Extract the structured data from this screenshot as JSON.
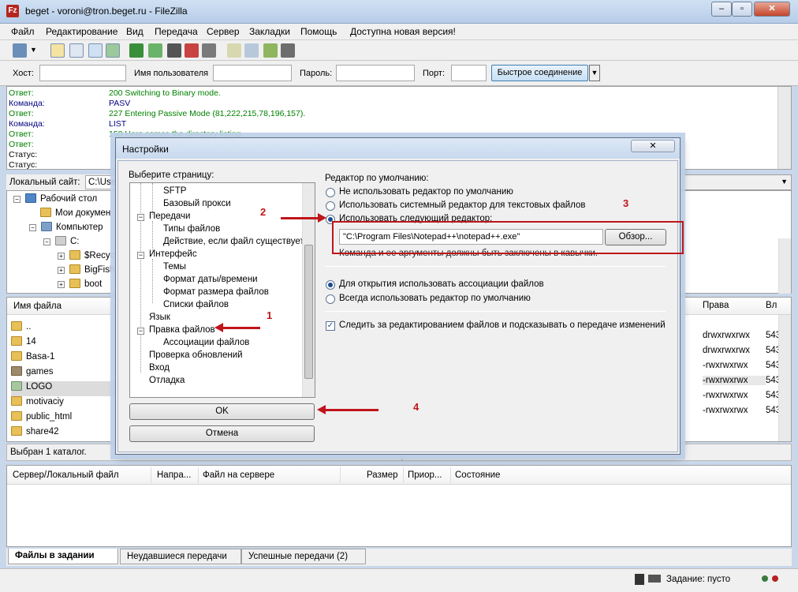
{
  "window": {
    "title": "beget - voroni@tron.beget.ru - FileZilla",
    "icon_label": "Fz",
    "minimize": "‒",
    "maximize": "▫",
    "close": "✕"
  },
  "menu": [
    "Файл",
    "Редактирование",
    "Вид",
    "Передача",
    "Сервер",
    "Закладки",
    "Помощь",
    "Доступна новая версия!"
  ],
  "quickconnect": {
    "host_label": "Хост:",
    "user_label": "Имя пользователя",
    "pass_label": "Пароль:",
    "port_label": "Порт:",
    "button": "Быстрое соединение",
    "dropdown": "▼"
  },
  "log": [
    {
      "k": "Ответ:",
      "v": "200 Switching to Binary mode.",
      "t": "resp"
    },
    {
      "k": "Команда:",
      "v": "PASV",
      "t": "cmd"
    },
    {
      "k": "Ответ:",
      "v": "227 Entering Passive Mode (81,222,215,78,196,157).",
      "t": "resp"
    },
    {
      "k": "Команда:",
      "v": "LIST",
      "t": "cmd"
    },
    {
      "k": "Ответ:",
      "v": "150 Here comes the directory listing.",
      "t": "resp"
    },
    {
      "k": "Ответ:",
      "v": "",
      "t": "resp"
    },
    {
      "k": "Статус:",
      "v": "",
      "t": "stat"
    },
    {
      "k": "Статус:",
      "v": "",
      "t": "stat"
    }
  ],
  "local": {
    "site_label": "Локальный сайт:",
    "site_value": "C:\\User",
    "tree": [
      "Рабочий стол",
      "Мои докумен",
      "Компьютер",
      "C:",
      "$Recyc",
      "BigFish",
      "boot"
    ],
    "col_name": "Имя файла",
    "files": [
      "..",
      "14",
      "Basa-1",
      "games",
      "LOGO",
      "motivaciy",
      "public_html",
      "share42"
    ],
    "status": "Выбран 1 каталог."
  },
  "remote": {
    "col_perms": "Права",
    "col_owner": "Вл",
    "rows": [
      {
        "p": "drwxrwxrwx",
        "n": "543"
      },
      {
        "p": "drwxrwxrwx",
        "n": "543"
      },
      {
        "p": "-rwxrwxrwx",
        "n": "543"
      },
      {
        "p": "-rwxrwxrwx",
        "n": "543"
      },
      {
        "p": "-rwxrwxrwx",
        "n": "543"
      },
      {
        "p": "-rwxrwxrwx",
        "n": "543"
      },
      {
        "p": "-rwxrwxrwx",
        "n": "543"
      }
    ]
  },
  "queue": {
    "cols": [
      "Сервер/Локальный файл",
      "Напра...",
      "Файл на сервере",
      "Размер",
      "Приор...",
      "Состояние"
    ],
    "tabs": [
      "Файлы в задании",
      "Неудавшиеся передачи",
      "Успешные передачи (2)"
    ],
    "status": "Задание: пусто"
  },
  "dialog": {
    "title": "Настройки",
    "close": "✕",
    "select_label": "Выберите страницу:",
    "pages": [
      {
        "label": "SFTP"
      },
      {
        "label": "Базовый прокси"
      },
      {
        "label": "Передачи"
      },
      {
        "label": "Типы файлов"
      },
      {
        "label": "Действие, если файл существует"
      },
      {
        "label": "Интерфейс"
      },
      {
        "label": "Темы"
      },
      {
        "label": "Формат даты/времени"
      },
      {
        "label": "Формат размера файлов"
      },
      {
        "label": "Списки файлов"
      },
      {
        "label": "Язык"
      },
      {
        "label": "Правка файлов"
      },
      {
        "label": "Ассоциации файлов"
      },
      {
        "label": "Проверка обновлений"
      },
      {
        "label": "Вход"
      },
      {
        "label": "Отладка"
      }
    ],
    "ok": "OK",
    "cancel": "Отмена",
    "default_editor_label": "Редактор по умолчанию:",
    "opt_none": "Не использовать редактор по умолчанию",
    "opt_system": "Использовать системный редактор для текстовых файлов",
    "opt_custom": "Использовать следующий редактор:",
    "editor_path": "\"C:\\Program Files\\Notepad++\\notepad++.exe\"",
    "browse": "Обзор...",
    "hint": "Команда и ее аргументы должны быть заключены в кавычки.",
    "opt_assoc": "Для открытия использовать ассоциации файлов",
    "opt_always": "Всегда использовать редактор по умолчанию",
    "watch": "Следить за редактированием файлов и подсказывать о передаче изменений",
    "selected_editor_option": "custom",
    "selected_open_option": "assoc",
    "watch_checked": true
  },
  "annotations": [
    "1",
    "2",
    "3",
    "4"
  ],
  "colors": {
    "annotation": "#c0151b",
    "response": "#008000",
    "command": "#000080"
  }
}
